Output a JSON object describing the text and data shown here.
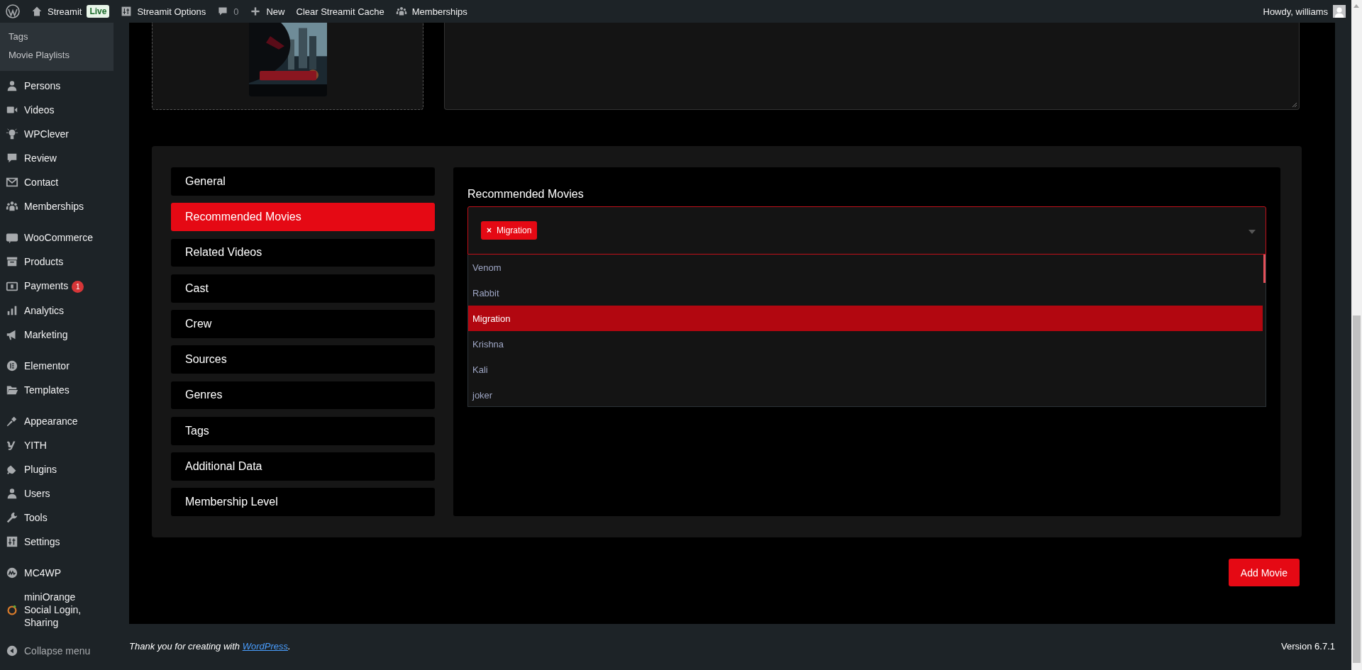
{
  "admin_bar": {
    "site": "Streamit",
    "live_badge": "Live",
    "items": [
      {
        "label": "Streamit Options"
      },
      {
        "label": "0"
      },
      {
        "label": "New"
      },
      {
        "label": "Clear Streamit Cache"
      },
      {
        "label": "Memberships"
      }
    ],
    "greeting": "Howdy, williams"
  },
  "sidebar": {
    "submenu": [
      {
        "label": "Tags"
      },
      {
        "label": "Movie Playlists"
      }
    ],
    "groups": [
      {
        "items": [
          {
            "label": "Persons"
          },
          {
            "label": "Videos"
          },
          {
            "label": "WPClever"
          },
          {
            "label": "Review"
          },
          {
            "label": "Contact"
          },
          {
            "label": "Memberships"
          }
        ]
      },
      {
        "items": [
          {
            "label": "WooCommerce"
          },
          {
            "label": "Products"
          },
          {
            "label": "Payments",
            "badge": "1"
          },
          {
            "label": "Analytics"
          },
          {
            "label": "Marketing"
          }
        ]
      },
      {
        "items": [
          {
            "label": "Elementor"
          },
          {
            "label": "Templates"
          }
        ]
      },
      {
        "items": [
          {
            "label": "Appearance"
          },
          {
            "label": "YITH"
          },
          {
            "label": "Plugins"
          },
          {
            "label": "Users"
          },
          {
            "label": "Tools"
          },
          {
            "label": "Settings"
          }
        ]
      },
      {
        "items": [
          {
            "label": "MC4WP"
          },
          {
            "label": "miniOrange Social Login, Sharing"
          }
        ]
      }
    ],
    "collapse": "Collapse menu"
  },
  "editor": {
    "tabs": [
      {
        "label": "General",
        "selected": false
      },
      {
        "label": "Recommended Movies",
        "selected": true
      },
      {
        "label": "Related Videos",
        "selected": false
      },
      {
        "label": "Cast",
        "selected": false
      },
      {
        "label": "Crew",
        "selected": false
      },
      {
        "label": "Sources",
        "selected": false
      },
      {
        "label": "Genres",
        "selected": false
      },
      {
        "label": "Tags",
        "selected": false
      },
      {
        "label": "Additional Data",
        "selected": false
      },
      {
        "label": "Membership Level",
        "selected": false
      }
    ],
    "field_label": "Recommended Movies",
    "tokens": [
      {
        "label": "Migration",
        "remove": "×"
      }
    ],
    "options": [
      {
        "label": "Venom",
        "selected": false
      },
      {
        "label": "Rabbit",
        "selected": false
      },
      {
        "label": "Migration",
        "selected": true
      },
      {
        "label": "Krishna",
        "selected": false
      },
      {
        "label": "Kali",
        "selected": false
      },
      {
        "label": "joker",
        "selected": false
      }
    ],
    "submit": "Add Movie"
  },
  "footer": {
    "thanks_prefix": "Thank you for creating with ",
    "thanks_link": "WordPress",
    "thanks_suffix": ".",
    "version": "Version 6.7.1"
  }
}
